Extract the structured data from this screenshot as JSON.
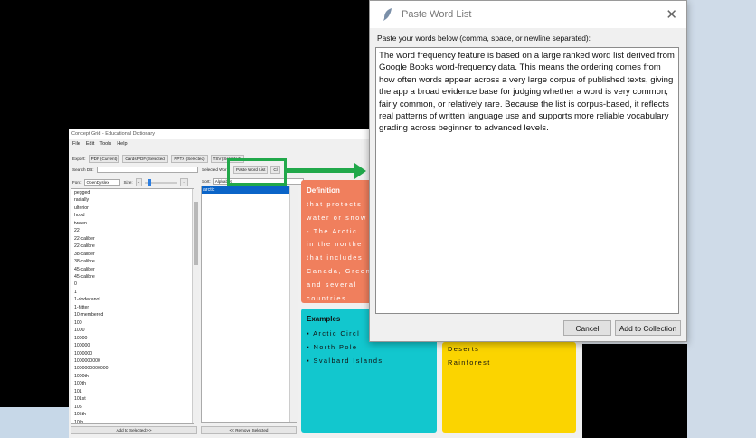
{
  "app": {
    "title": "Concept Grid - Educational Dictionary",
    "menu": [
      "File",
      "Edit",
      "Tools",
      "Help"
    ],
    "export_label": "Export:",
    "export_buttons": [
      "PDF (Current)",
      "Cards PDF (Selected)",
      "PPTX (Selected)",
      "TSV (Selected)"
    ],
    "search_label": "Search DB:",
    "font_label": "Font:",
    "font_value": "OpenDyslex",
    "size_label": "Size:",
    "size_minus": "-",
    "size_plus": "+",
    "selected_words_label": "Selected Wor",
    "paste_word_list_button": "Paste Word List",
    "clear_button": "Cl",
    "sort_label": "Sort:",
    "sort_value": "Alphabet",
    "word_list": [
      "pegged",
      "racially",
      "ulterior",
      "hood",
      "tween",
      "22",
      "22-caliber",
      "22-calibre",
      "38-caliber",
      "38-calibre",
      "45-caliber",
      "45-calibre",
      "0",
      "1",
      "1-dodecanol",
      "1-hitter",
      "10-membered",
      "100",
      "1000",
      "10000",
      "100000",
      "1000000",
      "1000000000",
      "1000000000000",
      "1000th",
      "100th",
      "101",
      "101st",
      "105",
      "105th",
      "10th"
    ],
    "selected_item": "arctic",
    "add_to_selected": "Add to Selected >>",
    "remove_selected": "<< Remove Selected",
    "definition_title": "Definition",
    "definition_lines": [
      "that protects",
      "water or snow",
      "- The Arctic",
      "in the northe",
      "that includes",
      "Canada, Green",
      "and several",
      "countries."
    ],
    "examples_title": "Examples",
    "examples": [
      "Arctic Circl",
      "North Pole",
      "Svalbard Islands"
    ],
    "right_examples": [
      "Deserts",
      "Rainforest"
    ]
  },
  "dialog": {
    "title": "Paste Word List",
    "close_glyph": "✕",
    "prompt": "Paste your words below (comma, space, or newline separated):",
    "text": "The word frequency feature is based on a large ranked word list derived from Google Books word-frequency data. This means the ordering comes from how often words appear across a very large corpus of published texts, giving the app a broad evidence base for judging whether a word is very common, fairly common, or relatively rare. Because the list is corpus-based, it reflects real patterns of written language use and supports more reliable vocabulary grading across beginner to advanced levels.",
    "cancel": "Cancel",
    "add": "Add to Collection"
  },
  "colors": {
    "definition": "#f07f5d",
    "examples": "#12c7ce",
    "right": "#fbd400",
    "highlight": "#21a84a"
  }
}
